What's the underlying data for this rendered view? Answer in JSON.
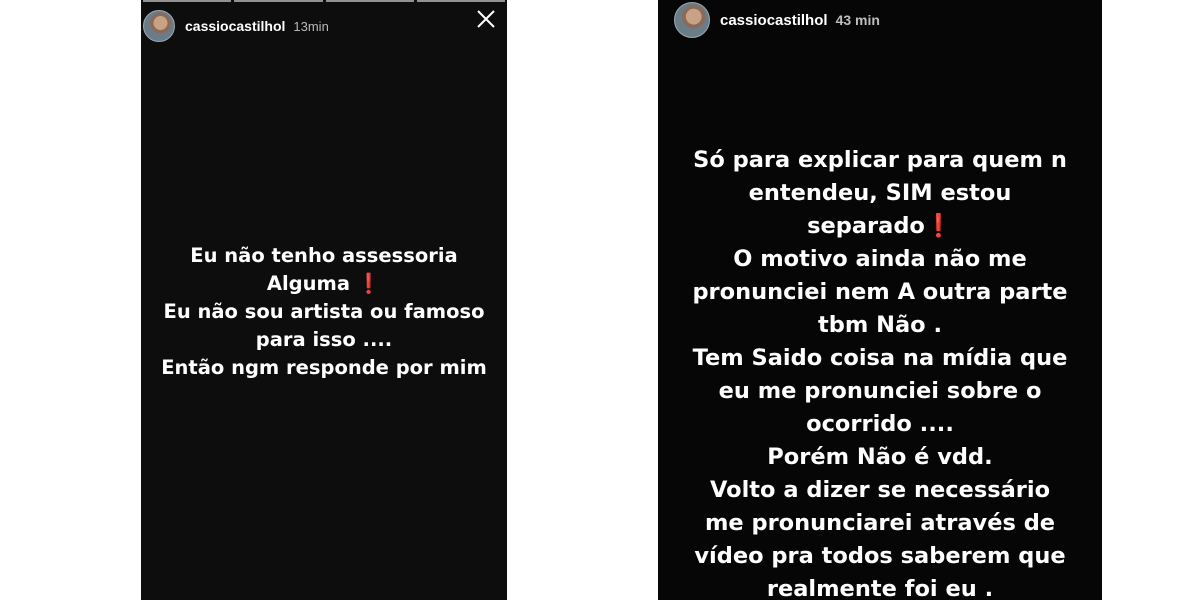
{
  "stories": [
    {
      "username": "cassiocastilhol",
      "time": "13min",
      "close_icon": "close-icon",
      "lines": [
        "Eu não tenho assessoria",
        "Alguma ",
        "Eu não sou artista ou famoso",
        "para isso ....",
        "Então ngm responde por mim"
      ],
      "emoji": "❗"
    },
    {
      "username": "cassiocastilhol",
      "time": "43 min",
      "lines": [
        "Só para explicar para quem n",
        "entendeu, SIM estou",
        "separado",
        "O motivo ainda não me",
        "pronunciei  nem A outra parte",
        "tbm Não .",
        "Tem Saido coisa na mídia que",
        "eu me pronunciei sobre o",
        "ocorrido ....",
        "Porém Não é vdd.",
        "Volto a dizer se necessário",
        "me pronunciarei através de",
        "vídeo pra todos saberem que",
        "realmente foi eu ."
      ],
      "emoji": "❗"
    }
  ],
  "colors": {
    "story_background": "#0a0a0a",
    "text": "#ffffff",
    "exclamation": "#e01e2b"
  }
}
